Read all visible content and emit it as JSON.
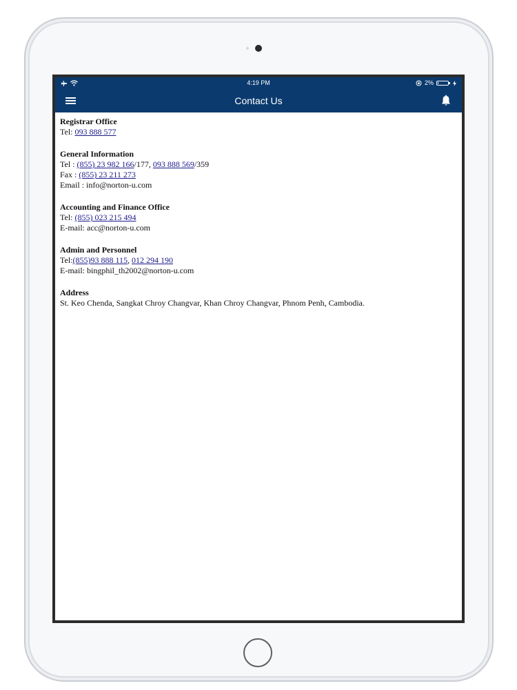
{
  "status_bar": {
    "time": "4:19 PM",
    "battery_percent": "2%",
    "battery_level": 0.02,
    "icons": [
      "airplane-icon",
      "wifi-icon",
      "rotation-lock-icon",
      "battery-icon",
      "charging-icon"
    ]
  },
  "nav": {
    "title": "Contact Us",
    "menu_icon": "hamburger-icon",
    "bell_icon": "bell-icon",
    "bar_color": "#0b3a6e"
  },
  "sections": {
    "registrar": {
      "title": "Registrar Office",
      "tel_label": "Tel: ",
      "tel": "093 888 577"
    },
    "general": {
      "title": "General Information",
      "tel_label": "Tel : ",
      "tel1": "(855) 23 982 166",
      "tel1_ext": "/177, ",
      "tel2": "093 888 569",
      "tel2_ext": "/359",
      "fax_label": "Fax : ",
      "fax": "(855) 23 211 273",
      "email_line": "Email : info@norton-u.com"
    },
    "accounting": {
      "title": "Accounting and Finance Office",
      "tel_label": "Tel: ",
      "tel": "(855) 023 215 494",
      "email_line": "E-mail: acc@norton-u.com"
    },
    "admin": {
      "title": "Admin and Personnel",
      "tel_label": "Tel:",
      "tel1": "(855)93 888 115",
      "separator": ", ",
      "tel2": "012 294 190",
      "email_line": "E-mail: bingphil_th2002@norton-u.com"
    },
    "address": {
      "title": "Address",
      "text": "St. Keo Chenda, Sangkat Chroy Changvar, Khan Chroy Changvar, Phnom Penh, Cambodia."
    }
  },
  "colors": {
    "link": "#1a1a8c",
    "header": "#0b3a6e"
  }
}
